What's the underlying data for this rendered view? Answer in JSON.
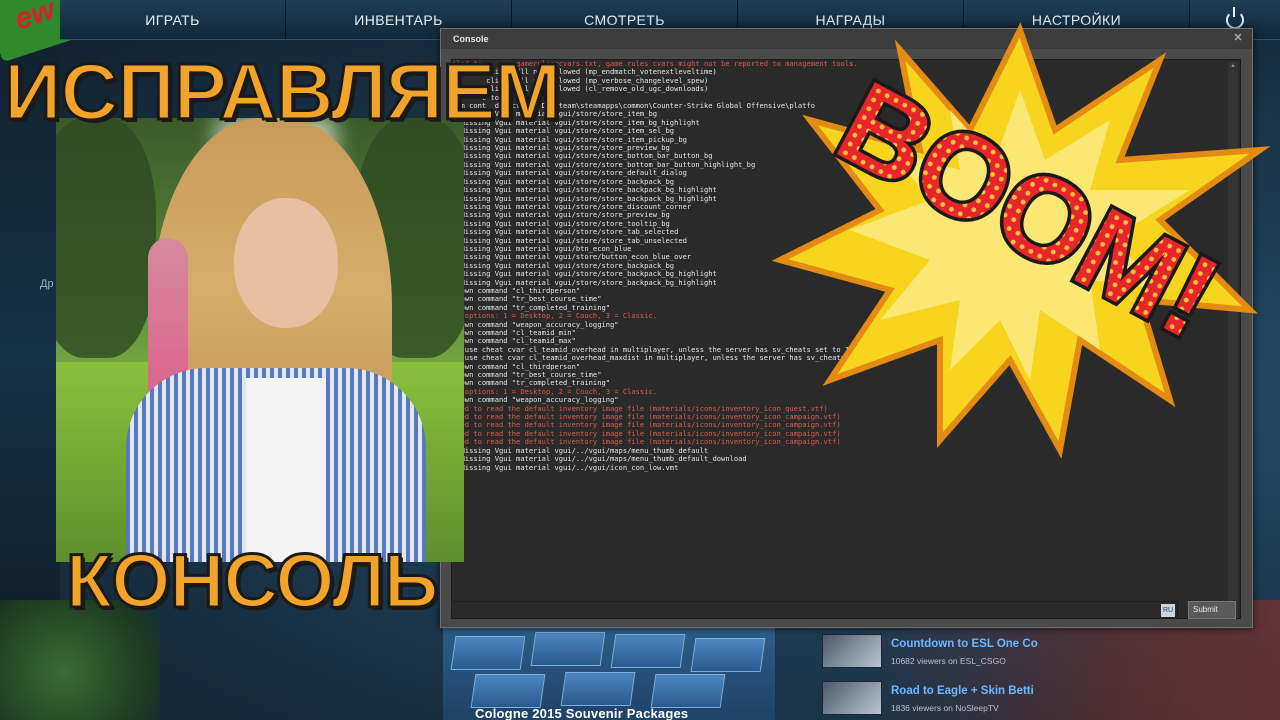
{
  "nav": {
    "items": [
      "ИГРАТЬ",
      "ИНВЕНТАРЬ",
      "СМОТРЕТЬ",
      "НАГРАДЫ",
      "НАСТРОЙКИ"
    ],
    "power_icon": "power-icon"
  },
  "brand_logo_text": "ew",
  "side_label": "Др",
  "headline": {
    "top": "ИСПРАВЛЯЕМ",
    "bottom": "КОНСОЛЬ"
  },
  "console": {
    "title": "Console",
    "close_icon": "close-icon",
    "input_value": "",
    "lang_badge": "RU",
    "submit_label": "Submit",
    "lines": [
      {
        "t": "iled to        gameruleszcvars.txt, game rules cvars might not be reported to management tools.",
        "c": "err"
      },
      {
        "t": "t       client.dll not allowed (mp_endmatch_votenextleveltime)",
        "c": ""
      },
      {
        "t": "t       client.dll not allowed (mp_verbose_changelevel_spew)",
        "c": ""
      },
      {
        "t": "t       client.dll not allowed (cl_remove_old_ugc_downloads)",
        "c": ""
      },
      {
        "t": "       t to 64",
        "c": ""
      },
      {
        "t": "tem cont  directory: D:\\Steam\\steamapps\\common\\Counter-Strike Global Offensive\\platfo",
        "c": ""
      },
      {
        "t": "- Missing Vgui material vgui/store/store_item_bg",
        "c": ""
      },
      {
        "t": "- Missing Vgui material vgui/store/store_item_bg_highlight",
        "c": ""
      },
      {
        "t": "- Missing Vgui material vgui/store/store_item_sel_bg",
        "c": ""
      },
      {
        "t": "- Missing Vgui material vgui/store/store_item_pickup_bg",
        "c": ""
      },
      {
        "t": "- Missing Vgui material vgui/store/store_preview_bg",
        "c": ""
      },
      {
        "t": "- Missing Vgui material vgui/store/store_bottom_bar_button_bg",
        "c": ""
      },
      {
        "t": "- Missing Vgui material vgui/store/store_bottom_bar_button_highlight_bg",
        "c": ""
      },
      {
        "t": "- Missing Vgui material vgui/store/store_default_dialog",
        "c": ""
      },
      {
        "t": "- Missing Vgui material vgui/store/store_backpack_bg",
        "c": ""
      },
      {
        "t": "- Missing Vgui material vgui/store/store_backpack_bg_highlight",
        "c": ""
      },
      {
        "t": "- Missing Vgui material vgui/store/store_backpack_bg_highlight",
        "c": ""
      },
      {
        "t": "- Missing Vgui material vgui/store/store_discount_corner",
        "c": ""
      },
      {
        "t": "- Missing Vgui material vgui/store/store_preview_bg",
        "c": ""
      },
      {
        "t": "- Missing Vgui material vgui/store/store_tooltip_bg",
        "c": ""
      },
      {
        "t": "- Missing Vgui material vgui/store/store_tab_selected",
        "c": ""
      },
      {
        "t": "- Missing Vgui material vgui/store/store_tab_unselected",
        "c": ""
      },
      {
        "t": "- Missing Vgui material vgui/btn_econ_blue",
        "c": ""
      },
      {
        "t": "- Missing Vgui material vgui/store/button_econ_blue_over",
        "c": ""
      },
      {
        "t": "- Missing Vgui material vgui/store/store_backpack_bg",
        "c": ""
      },
      {
        "t": "- Missing Vgui material vgui/store/store_backpack_bg_highlight",
        "c": ""
      },
      {
        "t": "- Missing Vgui material vgui/store/store_backpack_bg_highlight",
        "c": ""
      },
      {
        "t": "known command \"cl_thirdperson\"",
        "c": ""
      },
      {
        "t": "known command \"tr_best_course_time\"",
        "c": ""
      },
      {
        "t": "known command \"tr_completed_training\"",
        "c": ""
      },
      {
        "t": "id options: 1 = Desktop, 2 = Couch, 3 = Classic.",
        "c": "err"
      },
      {
        "t": "known command \"weapon_accuracy_logging\"",
        "c": ""
      },
      {
        "t": "known command \"cl_teamid_min\"",
        "c": ""
      },
      {
        "t": "known command \"cl_teamid_max\"",
        "c": ""
      },
      {
        "t": "'t use cheat cvar cl_teamid_overhead in multiplayer, unless the server has sv_cheats set to 1.",
        "c": ""
      },
      {
        "t": "'t use cheat cvar cl_teamid_overhead_maxdist in multiplayer, unless the server has sv_cheats set to 1.",
        "c": ""
      },
      {
        "t": "known command \"cl_thirdperson\"",
        "c": ""
      },
      {
        "t": "known command \"tr_best_course_time\"",
        "c": ""
      },
      {
        "t": "known command \"tr_completed_training\"",
        "c": ""
      },
      {
        "t": "id options: 1 = Desktop, 2 = Couch, 3 = Classic.",
        "c": "err"
      },
      {
        "t": "known command \"weapon_accuracy_logging\"",
        "c": ""
      },
      {
        "t": "iled to read the default inventory image file (materials/icons/inventory_icon_quest.vtf)",
        "c": "err"
      },
      {
        "t": "iled to read the default inventory image file (materials/icons/inventory_icon_campaign.vtf)",
        "c": "err"
      },
      {
        "t": "iled to read the default inventory image file (materials/icons/inventory_icon_campaign.vtf)",
        "c": "err"
      },
      {
        "t": "iled to read the default inventory image file (materials/icons/inventory_icon_campaign.vtf)",
        "c": "err"
      },
      {
        "t": "iled to read the default inventory image file (materials/icons/inventory_icon_campaign.vtf)",
        "c": "err"
      },
      {
        "t": "- Missing Vgui material vgui/../vgui/maps/menu_thumb_default",
        "c": ""
      },
      {
        "t": "- Missing Vgui material vgui/../vgui/maps/menu_thumb_default_download",
        "c": ""
      },
      {
        "t": "- Missing Vgui material vgui/../vgui/icon_con_low.vmt",
        "c": ""
      }
    ]
  },
  "boom_text": "BOOM!",
  "packages": {
    "title": "Cologne 2015 Souvenir Packages"
  },
  "streams": [
    {
      "title": "Countdown to ESL One Co",
      "meta": "10682 viewers on ESL_CSGO"
    },
    {
      "title": "Road to Eagle + Skin Betti",
      "meta": "1836 viewers on NoSleepTV"
    }
  ],
  "colors": {
    "headline": "#f2a32a",
    "console_error": "#e05a50",
    "stream_link": "#6cb7ff",
    "boom_red": "#e8252b",
    "boom_yellow": "#f7d51e"
  }
}
